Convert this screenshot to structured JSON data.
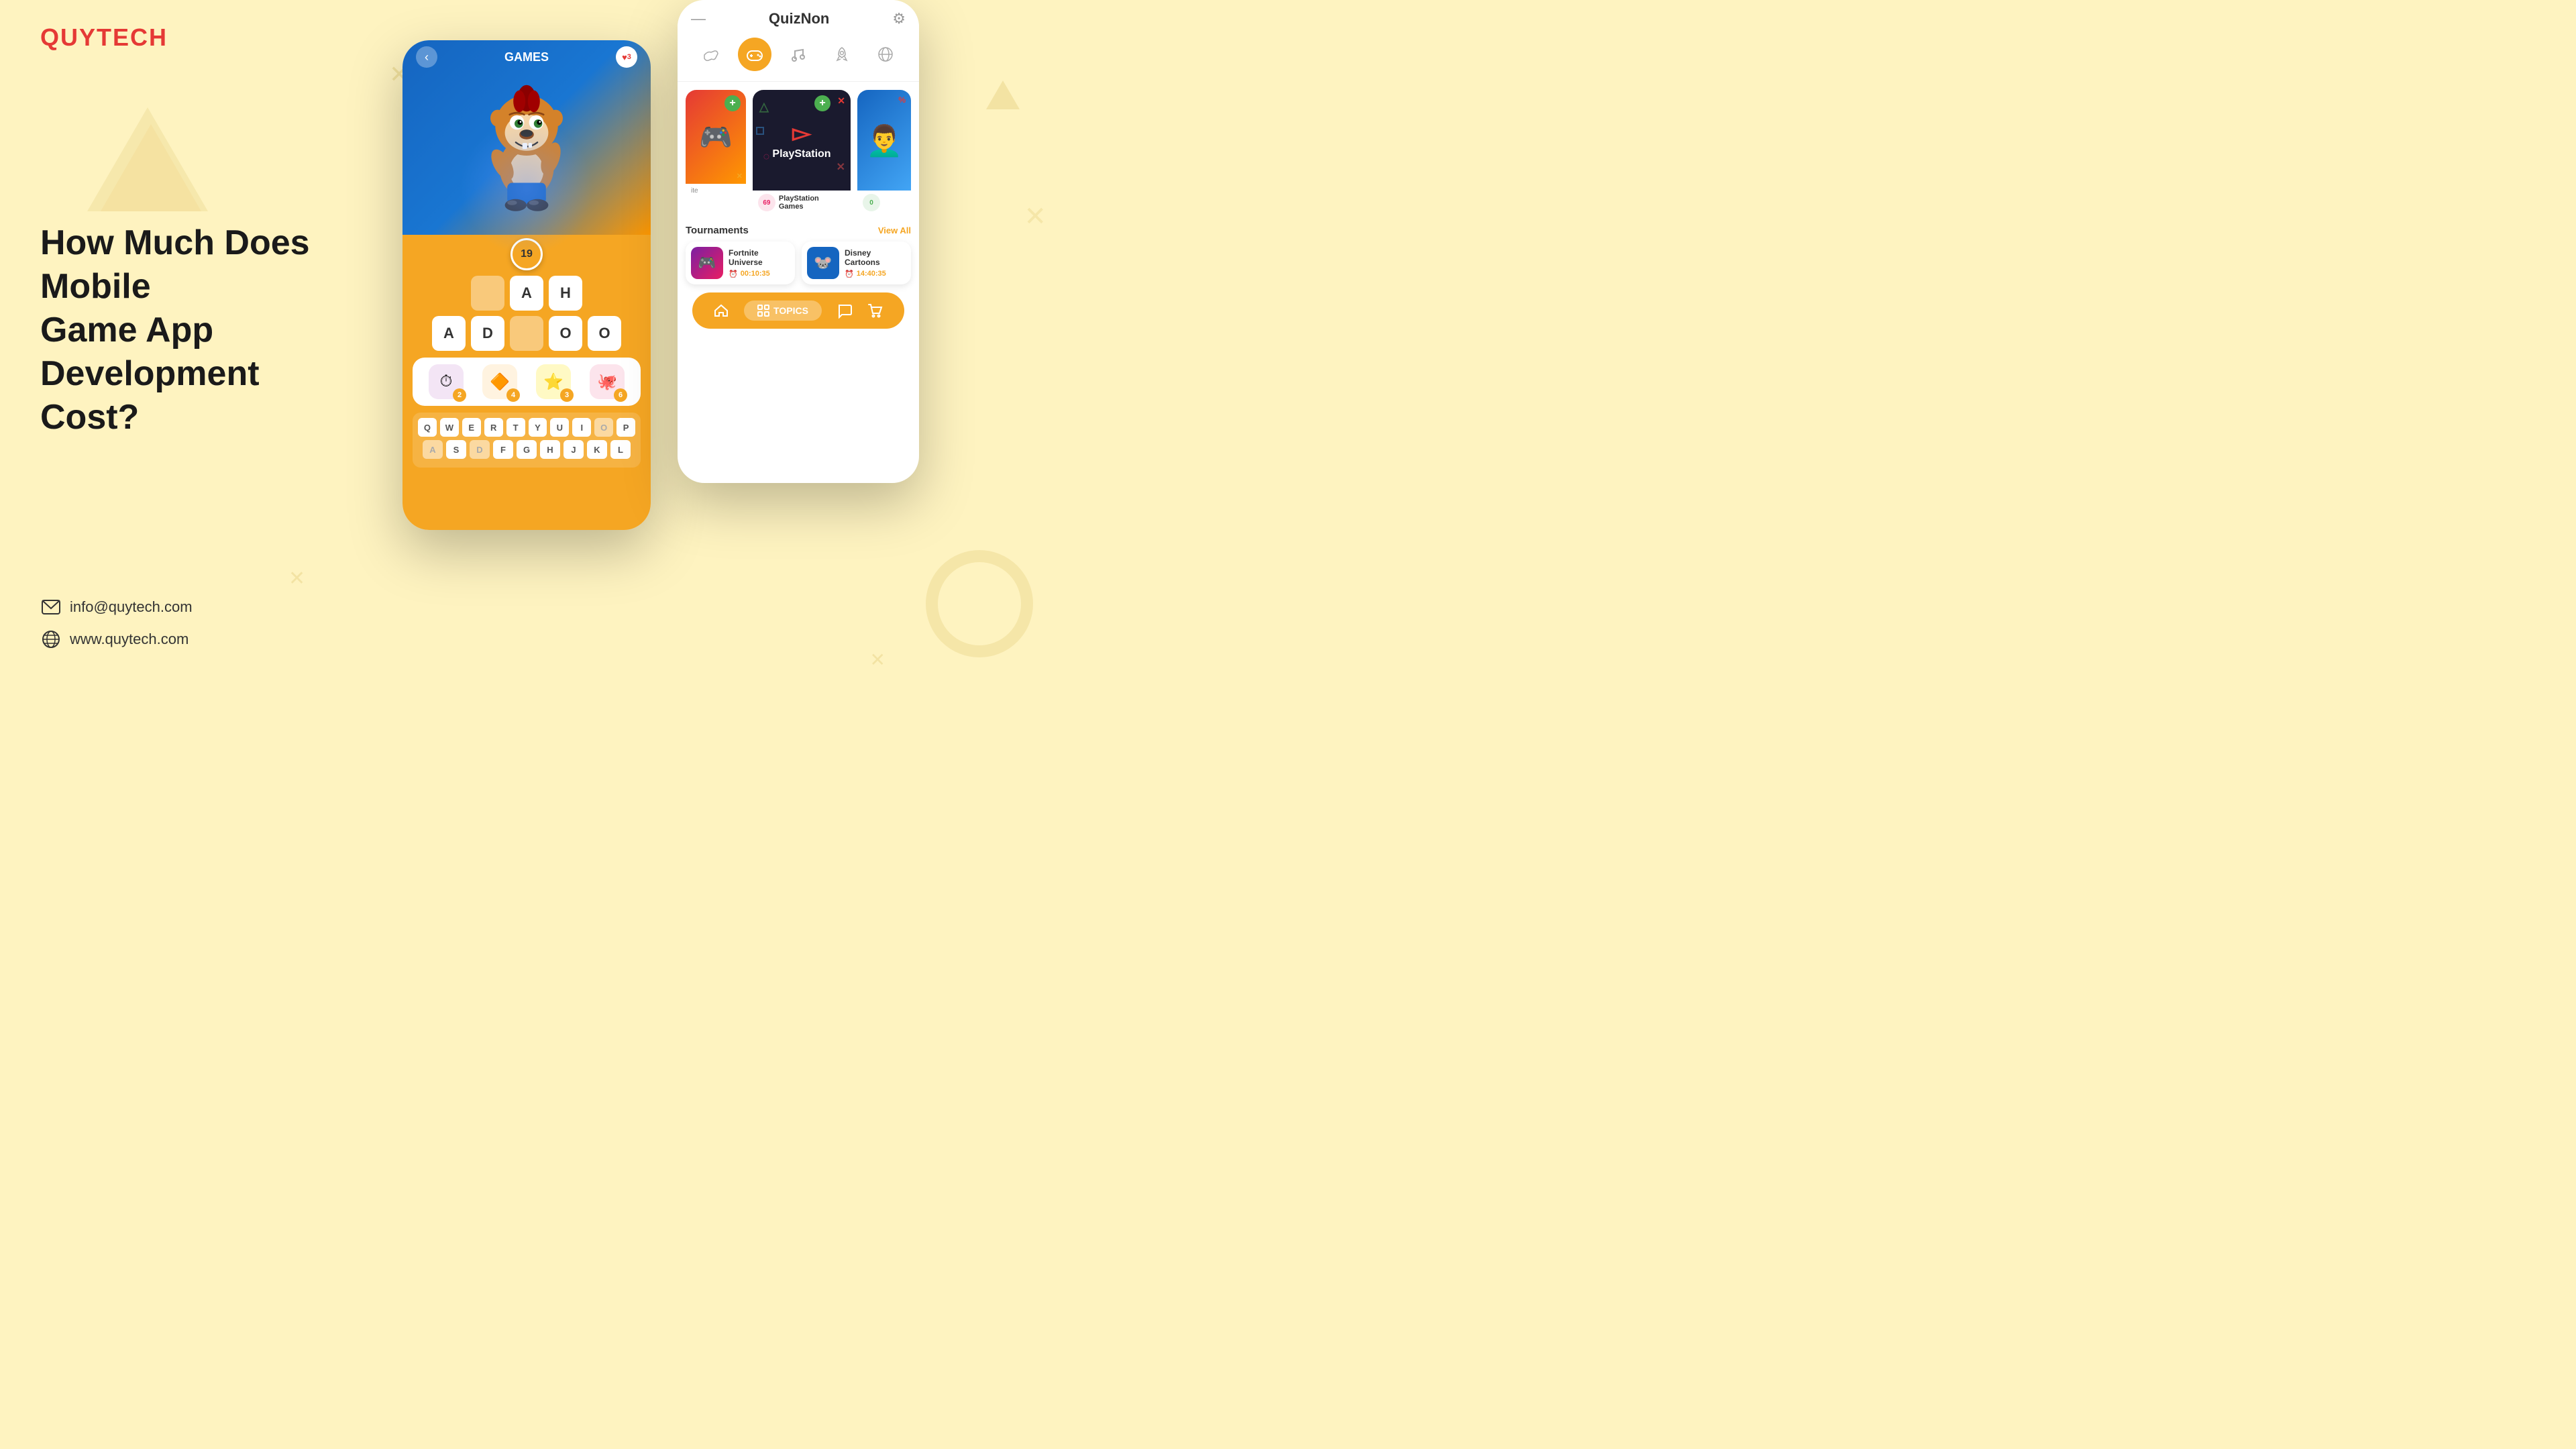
{
  "brand": {
    "logo": "QUYTECH",
    "logo_color": "#e53935"
  },
  "background": {
    "color": "#fef3c0"
  },
  "heading": {
    "line1": "How Much Does Mobile",
    "line2": "Game App Development",
    "line3": "Cost?"
  },
  "contact": {
    "email_icon": "✉",
    "email": "info@quytech.com",
    "web_icon": "🌐",
    "website": "www.quytech.com"
  },
  "phone1": {
    "back_arrow": "‹",
    "title": "GAMES",
    "heart_count": "3",
    "score": "19",
    "word_row1": [
      "",
      "A",
      "H"
    ],
    "word_row2": [
      "A",
      "D",
      "",
      "O",
      "O"
    ],
    "powerups": [
      {
        "icon": "⏱",
        "count": "2",
        "bg": "#9c27b0"
      },
      {
        "icon": "🔷",
        "count": "4",
        "bg": "#ff9800"
      },
      {
        "icon": "⭐",
        "count": "3",
        "bg": "#f5a623"
      },
      {
        "icon": "🐙",
        "count": "6",
        "bg": "#e91e63"
      }
    ],
    "keyboard_row1": [
      "Q",
      "W",
      "E",
      "R",
      "T",
      "Y",
      "U",
      "I",
      "O",
      "P"
    ],
    "keyboard_row2": [
      "A",
      "S",
      "D",
      "F",
      "G",
      "H",
      "J",
      "K",
      "L"
    ]
  },
  "phone2": {
    "title": "QuizNon",
    "gear_icon": "⚙",
    "nav_icons": [
      "🤝",
      "🎮",
      "🎵",
      "🚀",
      "🌐"
    ],
    "active_nav": 1,
    "games_section": {
      "label_1": "",
      "ps_label": "PlayStation",
      "ps_rating": "69",
      "ps_sublabel": "PlayStation Games",
      "add_icon": "+",
      "minus_icon": "—"
    },
    "tournaments": {
      "title": "Tournaments",
      "view_all": "View All",
      "items": [
        {
          "name": "Fortnite Universe",
          "time": "00:10:35"
        },
        {
          "name": "Disney Cartoons",
          "time": "14:40:35"
        }
      ]
    },
    "bottom_nav": {
      "home_icon": "🏠",
      "topics_icon": "⊞",
      "topics_label": "TOPICS",
      "chat_icon": "💬",
      "cart_icon": "🛒"
    }
  }
}
